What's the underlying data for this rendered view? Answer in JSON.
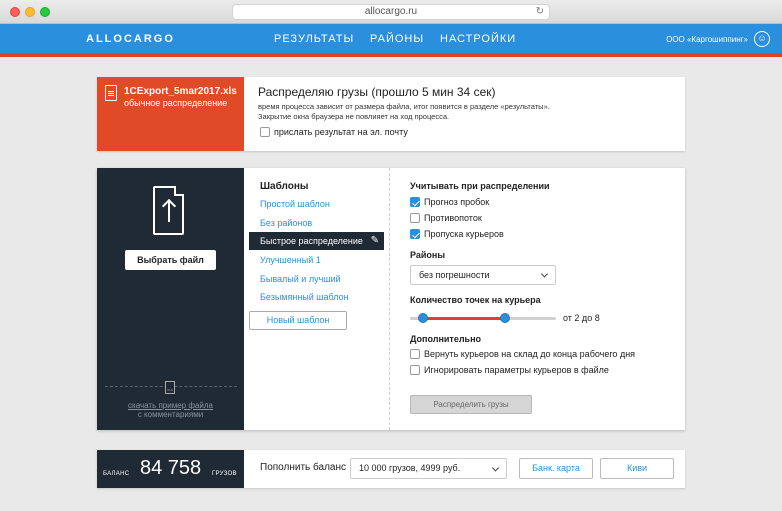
{
  "browser": {
    "url": "allocargo.ru"
  },
  "header": {
    "logo": "ALLOCARGO",
    "nav": [
      "РЕЗУЛЬТАТЫ",
      "РАЙОНЫ",
      "НАСТРОЙКИ"
    ],
    "company": "ООО «Каргошиппинг»"
  },
  "file": {
    "name": "1CExport_5mar2017.xls",
    "mode": "обычное распределение"
  },
  "process": {
    "title": "Распределяю грузы (прошло 5 мин 34 сек)",
    "note1": "время процесса зависит от размера файла, итог появится в разделе «результаты».",
    "note2": "Закрытие окна браузера не повлияет на ход процесса.",
    "email_label": "прислать результат на эл. почту",
    "email_checked": false
  },
  "upload": {
    "choose_label": "Выбрать файл",
    "sample_link": "скачать пример файла",
    "sample_sub": "с комментариями"
  },
  "templates": {
    "title": "Шаблоны",
    "items": [
      "Простой шаблон",
      "Без районов",
      "Быстрое распределение",
      "Улучшенный 1",
      "Бывалый и лучший",
      "Безымянный шаблон"
    ],
    "active_index": 2,
    "new_label": "Новый шаблон"
  },
  "settings": {
    "consider_title": "Учитывать при распределении",
    "consider": [
      {
        "label": "Прогноз пробок",
        "checked": true
      },
      {
        "label": "Противопоток",
        "checked": false
      },
      {
        "label": "Пропуска курьеров",
        "checked": true
      }
    ],
    "districts_title": "Районы",
    "districts_value": "без погрешности",
    "points_title": "Количество точек на курьера",
    "points_min": 2,
    "points_max": 8,
    "points_label": "от 2 до 8",
    "extra_title": "Дополнительно",
    "extra": [
      {
        "label": "Вернуть курьеров на склад до конца рабочего дня",
        "checked": false
      },
      {
        "label": "Игнорировать параметры курьеров в файле",
        "checked": false
      }
    ],
    "distribute_label": "Распределить грузы"
  },
  "balance": {
    "label": "БАЛАНС",
    "value": "84 758",
    "unit": "ГРУЗОВ",
    "topup_label": "Пополнить баланс",
    "package": "10 000 грузов, 4999 руб.",
    "card_label": "Банк. карта",
    "qiwi_label": "Киви"
  },
  "colors": {
    "accent": "#2a8fdd",
    "header_stripe": "#e23f2a",
    "file_tile": "#e14a26",
    "dark_panel": "#1f2a35"
  }
}
